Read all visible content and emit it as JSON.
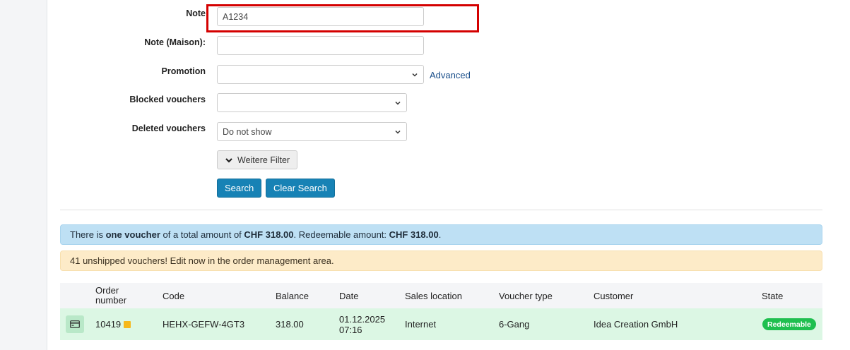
{
  "form": {
    "note": {
      "label": "Note",
      "value": "A1234"
    },
    "note_maison": {
      "label": "Note (Maison):",
      "value": ""
    },
    "promotion": {
      "label": "Promotion",
      "value": "",
      "advanced_link": "Advanced"
    },
    "blocked_vouchers": {
      "label": "Blocked vouchers",
      "value": ""
    },
    "deleted_vouchers": {
      "label": "Deleted vouchers",
      "value": "Do not show"
    },
    "more_filters": "Weitere Filter",
    "search": "Search",
    "clear_search": "Clear Search"
  },
  "alerts": {
    "info": {
      "p1": "There is ",
      "count": "one voucher",
      "p2": " of a total amount of ",
      "total": "CHF 318.00",
      "p3": ". Redeemable amount: ",
      "redeemable": "CHF 318.00",
      "p4": "."
    },
    "warning": "41 unshipped vouchers! Edit now in the order management area."
  },
  "table": {
    "headers": {
      "order_number_1": "Order",
      "order_number_2": "number",
      "code": "Code",
      "balance": "Balance",
      "date": "Date",
      "sales_location": "Sales location",
      "voucher_type": "Voucher type",
      "customer": "Customer",
      "state": "State"
    },
    "rows": [
      {
        "order_number": "10419",
        "code": "HEHX-GEFW-4GT3",
        "balance": "318.00",
        "date_1": "01.12.2025",
        "date_2": "07:16",
        "sales_location": "Internet",
        "voucher_type": "6-Gang",
        "customer": "Idea Creation GmbH",
        "state": "Redeemable"
      }
    ]
  },
  "colors": {
    "primary": "#1782b5",
    "info_bg": "#bee0f4",
    "warning_bg": "#fdebc8",
    "row_bg": "#dcf7e4",
    "badge": "#1fbf4f",
    "highlight": "#d40000"
  },
  "icons": {
    "chevron": "chevron-down-icon",
    "card": "credit-card-icon",
    "note": "note-icon"
  }
}
